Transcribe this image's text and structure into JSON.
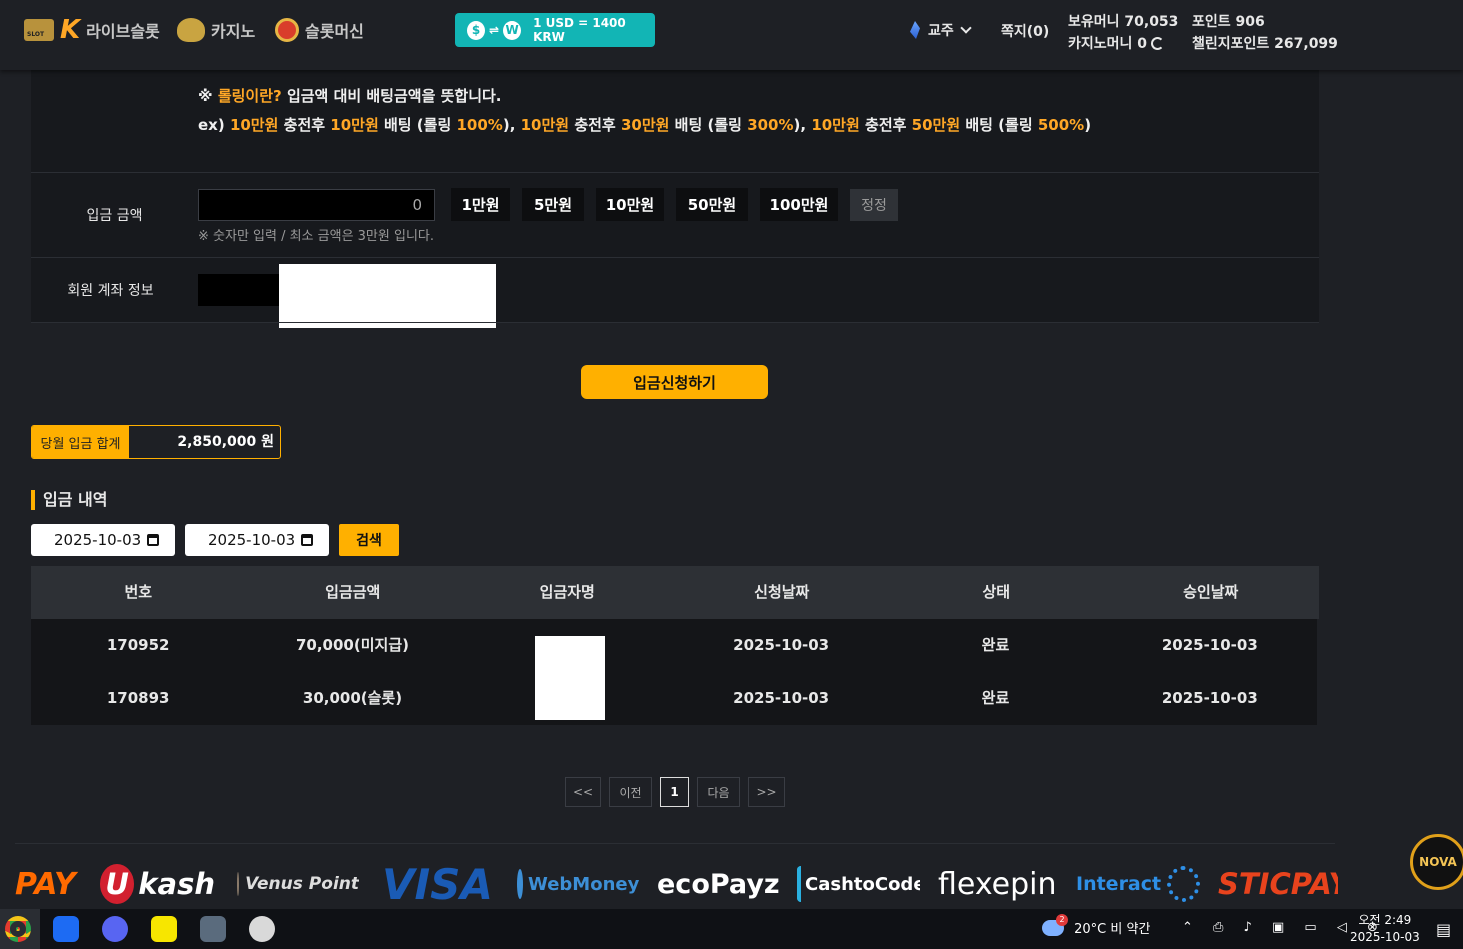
{
  "header": {
    "nav": [
      {
        "label": "라이브슬롯",
        "icon": "slot-k-logo-icon"
      },
      {
        "label": "카지노",
        "icon": "casino-wing-icon"
      },
      {
        "label": "슬롯머신",
        "icon": "slot-wheel-icon"
      }
    ],
    "rate": {
      "from_symbol": "$",
      "to_symbol": "W",
      "text": "1 USD = 1400 KRW"
    },
    "language": "교주",
    "memo": "쪽지(0)",
    "holding_money": "보유머니 70,053",
    "casino_money": "카지노머니 0",
    "points": "포인트 906",
    "challenge_points": "챌린지포인트 267,099"
  },
  "notice": {
    "line1_prefix": "※ ",
    "line1_highlight": "롤링이란?",
    "line1_rest": " 입금액 대비 배팅금액을 뜻합니다.",
    "line2": [
      {
        "t": "ex) ",
        "h": false
      },
      {
        "t": "10만원",
        "h": true
      },
      {
        "t": " 충전후 ",
        "h": false
      },
      {
        "t": "10만원",
        "h": true
      },
      {
        "t": " 배팅 (롤링 ",
        "h": false
      },
      {
        "t": "100%",
        "h": true
      },
      {
        "t": "), ",
        "h": false
      },
      {
        "t": "10만원",
        "h": true
      },
      {
        "t": " 충전후 ",
        "h": false
      },
      {
        "t": "30만원",
        "h": true
      },
      {
        "t": " 배팅 (롤링 ",
        "h": false
      },
      {
        "t": "300%",
        "h": true
      },
      {
        "t": "), ",
        "h": false
      },
      {
        "t": "10만원",
        "h": true
      },
      {
        "t": " 충전후 ",
        "h": false
      },
      {
        "t": "50만원",
        "h": true
      },
      {
        "t": " 배팅 (롤링 ",
        "h": false
      },
      {
        "t": "500%",
        "h": true
      },
      {
        "t": ")",
        "h": false
      }
    ]
  },
  "deposit_form": {
    "amount_label": "입금 금액",
    "amount_value": "0",
    "quick_buttons": [
      "1만원",
      "5만원",
      "10만원",
      "50만원",
      "100만원"
    ],
    "reset_label": "정정",
    "hint": "※ 숫자만 입력 / 최소 금액은 3만원 입니다.",
    "account_label": "회원 계좌 정보",
    "submit_label": "입금신청하기"
  },
  "monthly_total": {
    "label": "당월 입금 합계",
    "value": "2,850,000 원"
  },
  "history": {
    "title": "입금 내역",
    "date_from": "2025-10-03",
    "date_to": "2025-10-03",
    "search_label": "검색",
    "columns": [
      "번호",
      "입금금액",
      "입금자명",
      "신청날짜",
      "상태",
      "승인날짜"
    ],
    "rows": [
      {
        "no": "170952",
        "amount": "70,000(미지급)",
        "name": "",
        "requested": "2025-10-03",
        "status": "완료",
        "approved": "2025-10-03"
      },
      {
        "no": "170893",
        "amount": "30,000(슬롯)",
        "name": "",
        "requested": "2025-10-03",
        "status": "완료",
        "approved": "2025-10-03"
      }
    ]
  },
  "pagination": {
    "first": "<<",
    "prev": "이전",
    "current": "1",
    "next": "다음",
    "last": ">>"
  },
  "payments": [
    "PAY",
    "Ukash",
    "Venus Point",
    "VISA",
    "WebMoney",
    "ecoPayz",
    "CashtoCode",
    "flexepin",
    "Interact",
    "STICPAY"
  ],
  "colors": {
    "accent": "#ffb000",
    "highlight": "#ffa726",
    "rate_badge": "#12b5b5",
    "background": "#1e2025"
  },
  "taskbar": {
    "apps": [
      "chrome-icon",
      "app-blue-icon",
      "discord-icon",
      "kakaotalk-icon",
      "calculator-icon",
      "paint-icon"
    ],
    "weather": "20°C 비 약간",
    "time": "오전 2:49",
    "date": "2025-10-03",
    "badge": "2"
  },
  "floating_logo": "NOVA"
}
